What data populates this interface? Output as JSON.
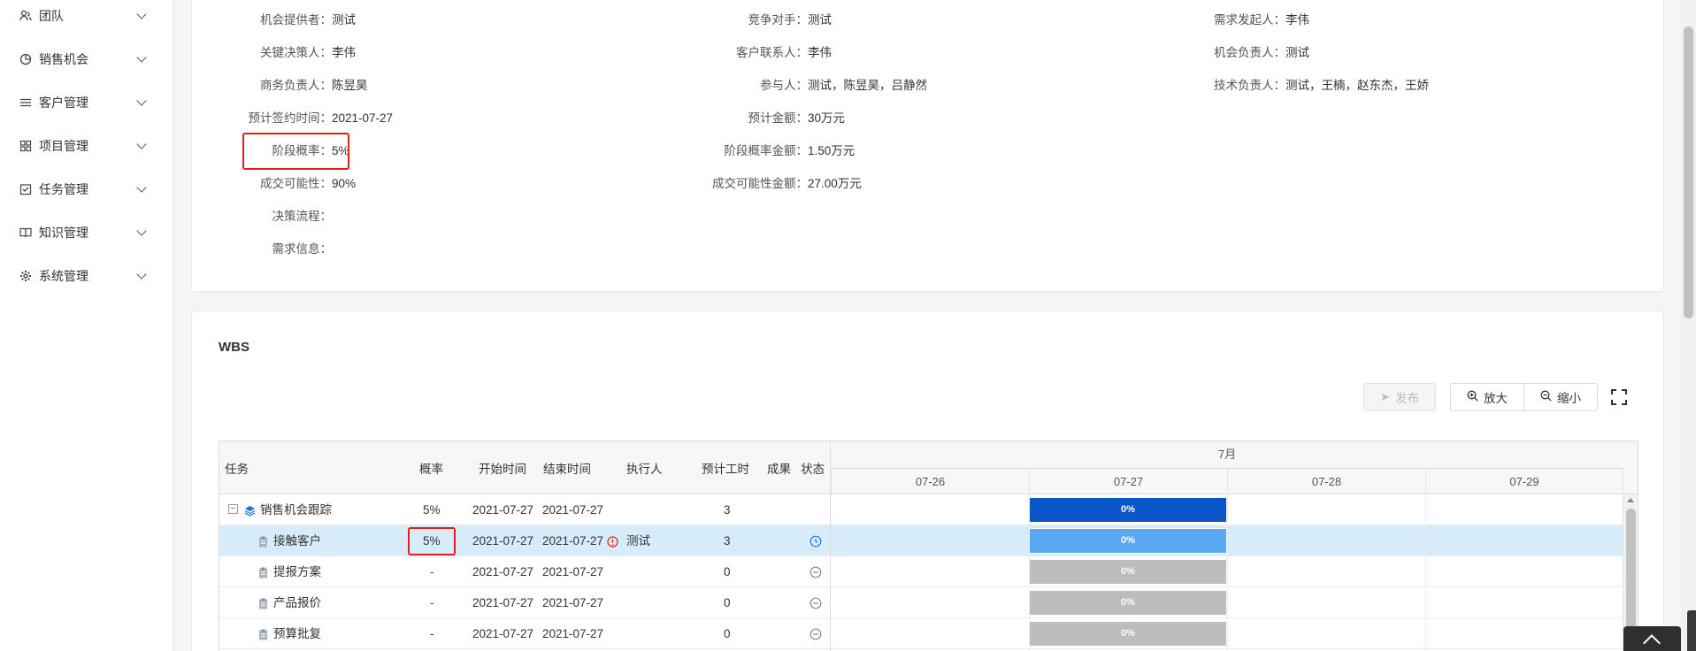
{
  "sidebar": {
    "items": [
      {
        "label": "团队",
        "icon": "team-icon"
      },
      {
        "label": "销售机会",
        "icon": "pie-chart-icon"
      },
      {
        "label": "客户管理",
        "icon": "list-icon"
      },
      {
        "label": "项目管理",
        "icon": "grid-icon"
      },
      {
        "label": "任务管理",
        "icon": "checkbox-icon"
      },
      {
        "label": "知识管理",
        "icon": "book-icon"
      },
      {
        "label": "系统管理",
        "icon": "gear-icon"
      }
    ]
  },
  "info": {
    "col1": [
      {
        "label": "机会提供者：",
        "value": "测试"
      },
      {
        "label": "关键决策人：",
        "value": "李伟"
      },
      {
        "label": "商务负责人：",
        "value": "陈昱昊"
      },
      {
        "label": "预计签约时间：",
        "value": "2021-07-27"
      },
      {
        "label": "阶段概率：",
        "value": "5%"
      },
      {
        "label": "成交可能性：",
        "value": "90%"
      },
      {
        "label": "决策流程：",
        "value": ""
      },
      {
        "label": "需求信息：",
        "value": ""
      }
    ],
    "col2": [
      {
        "label": "竞争对手：",
        "value": "测试"
      },
      {
        "label": "客户联系人：",
        "value": "李伟"
      },
      {
        "label": "参与人：",
        "value": "测试，陈昱昊，吕静然"
      },
      {
        "label": "预计金额：",
        "value": "30万元"
      },
      {
        "label": "阶段概率金额：",
        "value": "1.50万元"
      },
      {
        "label": "成交可能性金额：",
        "value": "27.00万元"
      }
    ],
    "col3": [
      {
        "label": "需求发起人：",
        "value": "李伟"
      },
      {
        "label": "机会负责人：",
        "value": "测试"
      },
      {
        "label": "技术负责人：",
        "value": "测试，王楠，赵东杰，王娇"
      }
    ]
  },
  "wbs": {
    "title": "WBS",
    "publish_label": "发布",
    "zoom_in_label": "放大",
    "zoom_out_label": "缩小",
    "columns": {
      "task": "任务",
      "prob": "概率",
      "start": "开始时间",
      "end": "结束时间",
      "assignee": "执行人",
      "hours": "预计工时",
      "result": "成果",
      "status": "状态"
    },
    "timeline": {
      "month": "7月",
      "days": [
        "07-26",
        "07-27",
        "07-28",
        "07-29"
      ]
    },
    "rows": [
      {
        "task": "销售机会跟踪",
        "prob": "5%",
        "start": "2021-07-27",
        "end": "2021-07-27",
        "assignee": "",
        "hours": "3",
        "progress": "0%",
        "bar_color": "#0a55c8",
        "status_icon": "",
        "level": 0
      },
      {
        "task": "接触客户",
        "prob": "5%",
        "start": "2021-07-27",
        "end": "2021-07-27",
        "assignee": "测试",
        "hours": "3",
        "progress": "0%",
        "bar_color": "#5aa9f5",
        "status_icon": "clock-icon",
        "level": 1
      },
      {
        "task": "提报方案",
        "prob": "-",
        "start": "2021-07-27",
        "end": "2021-07-27",
        "assignee": "",
        "hours": "0",
        "progress": "0%",
        "bar_color": "#bdbdbd",
        "status_icon": "minus-circle-icon",
        "level": 1
      },
      {
        "task": "产品报价",
        "prob": "-",
        "start": "2021-07-27",
        "end": "2021-07-27",
        "assignee": "",
        "hours": "0",
        "progress": "0%",
        "bar_color": "#bdbdbd",
        "status_icon": "minus-circle-icon",
        "level": 1
      },
      {
        "task": "预算批复",
        "prob": "-",
        "start": "2021-07-27",
        "end": "2021-07-27",
        "assignee": "",
        "hours": "0",
        "progress": "0%",
        "bar_color": "#bdbdbd",
        "status_icon": "minus-circle-icon",
        "level": 1
      }
    ]
  }
}
